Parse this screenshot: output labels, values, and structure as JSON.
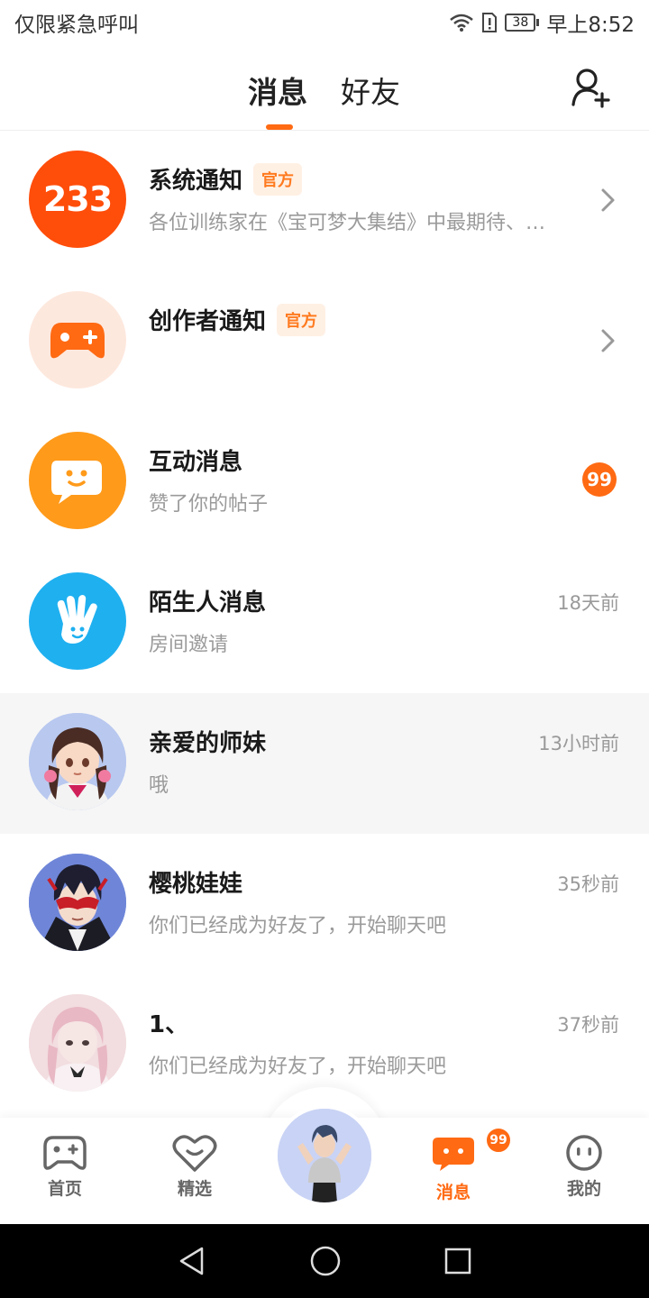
{
  "status_bar": {
    "carrier": "仅限紧急呼叫",
    "battery": "38",
    "time": "早上8:52"
  },
  "header": {
    "tabs": [
      {
        "label": "消息",
        "active": true
      },
      {
        "label": "好友",
        "active": false
      }
    ],
    "add_friend_icon": "add-person-icon"
  },
  "conversations": [
    {
      "title": "系统通知",
      "tag": "官方",
      "subtitle": "各位训练家在《宝可梦大集结》中最期待、…",
      "trailing": "chevron",
      "avatar_text": "233",
      "avatar_color": "#ff4d0a"
    },
    {
      "title": "创作者通知",
      "tag": "官方",
      "subtitle": "",
      "trailing": "chevron",
      "avatar_icon": "gamepad-plus-icon",
      "avatar_color": "#fde8de"
    },
    {
      "title": "互动消息",
      "subtitle": "赞了你的帖子",
      "badge": "99",
      "avatar_icon": "smile-chat-icon",
      "avatar_color": "#ff9a1a"
    },
    {
      "title": "陌生人消息",
      "subtitle": "房间邀请",
      "time": "18天前",
      "avatar_icon": "waving-hand-icon",
      "avatar_color": "#1fb0f0"
    },
    {
      "title": "亲爱的师妹",
      "subtitle": "哦",
      "time": "13小时前",
      "avatar_icon": "anime-girl-avatar",
      "highlighted": true
    },
    {
      "title": "樱桃娃娃",
      "subtitle": "你们已经成为好友了，开始聊天吧",
      "time": "35秒前",
      "avatar_icon": "masked-character-avatar"
    },
    {
      "title": "1、",
      "subtitle": "你们已经成为好友了，开始聊天吧",
      "time": "37秒前",
      "avatar_icon": "pink-character-avatar"
    }
  ],
  "bottom_nav": {
    "items": [
      {
        "label": "首页",
        "icon": "gamepad-icon"
      },
      {
        "label": "精选",
        "icon": "heart-chat-icon"
      },
      {
        "label": "消息",
        "icon": "message-icon",
        "badge": "99",
        "active": true
      },
      {
        "label": "我的",
        "icon": "face-icon"
      }
    ]
  },
  "colors": {
    "accent": "#ff6a13",
    "secondary_text": "#9a9a9a"
  }
}
